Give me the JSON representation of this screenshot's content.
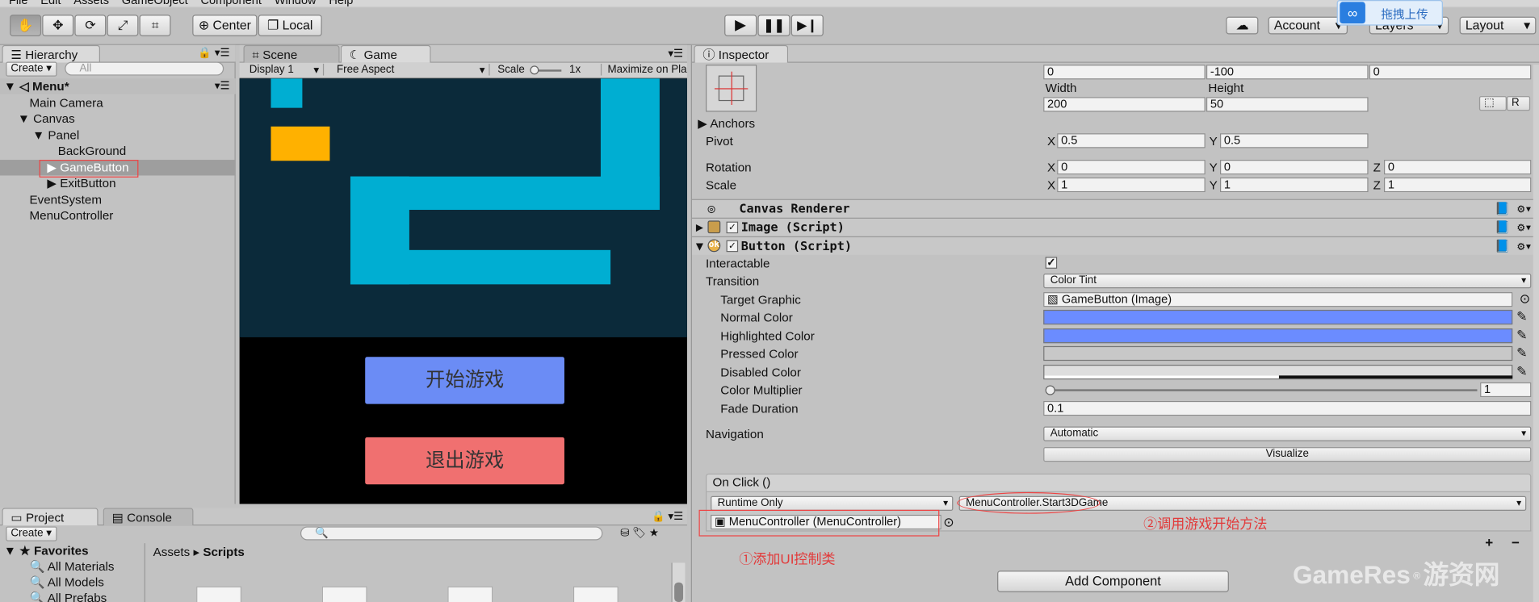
{
  "menu": [
    "File",
    "Edit",
    "Assets",
    "GameObject",
    "Component",
    "Window",
    "Help"
  ],
  "toolbar": {
    "center": "Center",
    "local": "Local",
    "account": "Account",
    "layers": "Layers",
    "layout": "Layout",
    "upload_badge": "拖拽上传"
  },
  "hierarchy": {
    "tab": "Hierarchy",
    "create": "Create",
    "search_placeholder": "All",
    "scene": "Menu*",
    "items": [
      "Main Camera",
      "Canvas",
      "Panel",
      "BackGround",
      "GameButton",
      "ExitButton",
      "EventSystem",
      "MenuController"
    ]
  },
  "game": {
    "scene_tab": "Scene",
    "game_tab": "Game",
    "display": "Display 1",
    "aspect": "Free Aspect",
    "scale_label": "Scale",
    "scale_value": "1x",
    "maximize": "Maximize on Pla",
    "start_button": "开始游戏",
    "exit_button": "退出游戏"
  },
  "project": {
    "tab": "Project",
    "console_tab": "Console",
    "create": "Create",
    "favorites": "Favorites",
    "fav_items": [
      "All Materials",
      "All Models",
      "All Prefabs"
    ],
    "path_root": "Assets",
    "path_folder": "Scripts"
  },
  "inspector": {
    "tab": "Inspector",
    "rect": {
      "v1": "0",
      "v2": "-100",
      "v3": "0",
      "width_label": "Width",
      "height_label": "Height",
      "width": "200",
      "height": "50",
      "r_button": "R"
    },
    "anchors": "Anchors",
    "pivot": "Pivot",
    "pivot_x": "0.5",
    "pivot_y": "0.5",
    "rotation": "Rotation",
    "rot_x": "0",
    "rot_y": "0",
    "rot_z": "0",
    "scale": "Scale",
    "scale_x": "1",
    "scale_y": "1",
    "scale_z": "1",
    "x": "X",
    "y": "Y",
    "z": "Z",
    "canvas_renderer": "Canvas Renderer",
    "image_script": "Image (Script)",
    "button_script": "Button (Script)",
    "interactable": "Interactable",
    "transition": "Transition",
    "transition_value": "Color Tint",
    "target_graphic": "Target Graphic",
    "target_graphic_value": "GameButton (Image)",
    "normal_color": "Normal Color",
    "highlighted_color": "Highlighted Color",
    "pressed_color": "Pressed Color",
    "disabled_color": "Disabled Color",
    "color_multiplier": "Color Multiplier",
    "color_multiplier_value": "1",
    "fade_duration": "Fade Duration",
    "fade_duration_value": "0.1",
    "navigation": "Navigation",
    "navigation_value": "Automatic",
    "visualize": "Visualize",
    "on_click": "On Click ()",
    "runtime": "Runtime Only",
    "function": "MenuController.Start3DGame",
    "object": "MenuController (MenuController)",
    "add_component": "Add Component"
  },
  "annotations": {
    "one": "①添加UI控制类",
    "two": "②调用游戏开始方法"
  },
  "watermark": "GameRes",
  "watermark_cn": "游资网",
  "colors": {
    "normal": "#6b8cff",
    "highlighted": "#6b8cff",
    "pressed": "#c8c8c8",
    "start_btn": "#6b8cf5",
    "exit_btn": "#f07070",
    "game_bg": "#0b2a3a",
    "tile": "#00aed2",
    "gold": "#ffb100"
  }
}
